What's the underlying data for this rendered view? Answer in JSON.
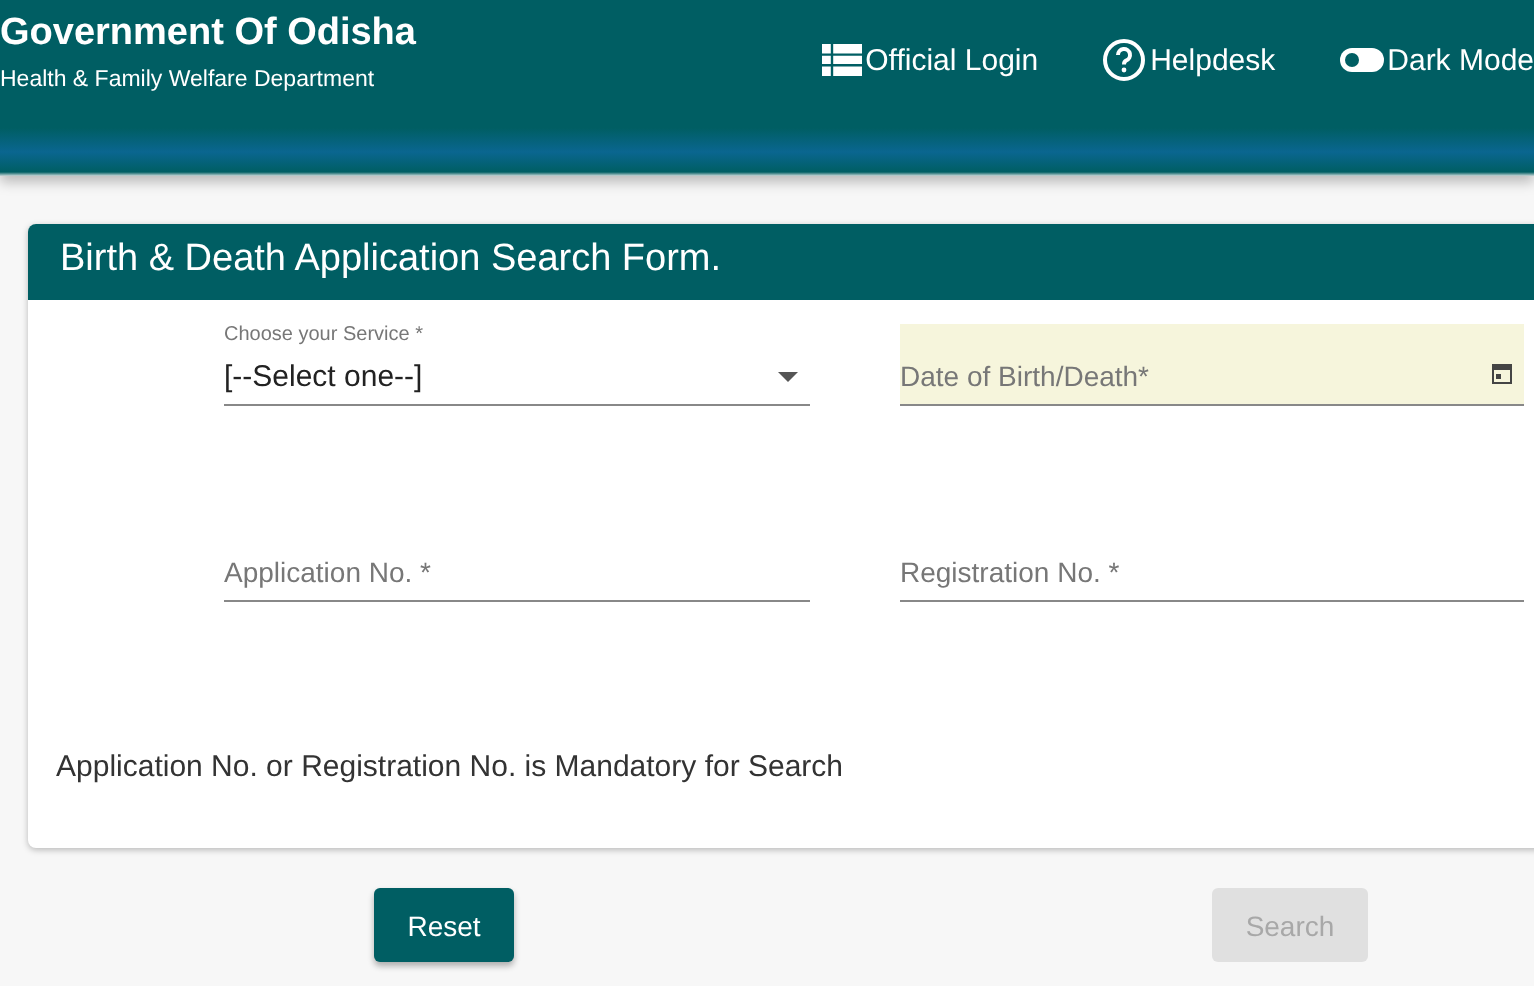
{
  "header": {
    "title": "Government Of Odisha",
    "subtitle": "Health & Family Welfare Department",
    "nav": [
      {
        "kind": "login",
        "label": "Official Login"
      },
      {
        "kind": "help",
        "label": "Helpdesk"
      },
      {
        "kind": "toggle",
        "label": "Dark Mode",
        "on": false
      }
    ]
  },
  "form": {
    "title": "Birth & Death Application Search Form.",
    "fields": [
      {
        "kind": "select",
        "label": "Choose your Service *",
        "value": "[--Select one--]"
      },
      {
        "kind": "date",
        "placeholder": "Date of Birth/Death*"
      },
      {
        "kind": "text",
        "placeholder": "Application No. *"
      },
      {
        "kind": "text",
        "placeholder": "Registration No. *"
      }
    ],
    "note": "Application No. or Registration No. is Mandatory for Search"
  },
  "buttons": [
    {
      "label": "Reset",
      "disabled": false
    },
    {
      "label": "Search",
      "disabled": true
    }
  ]
}
